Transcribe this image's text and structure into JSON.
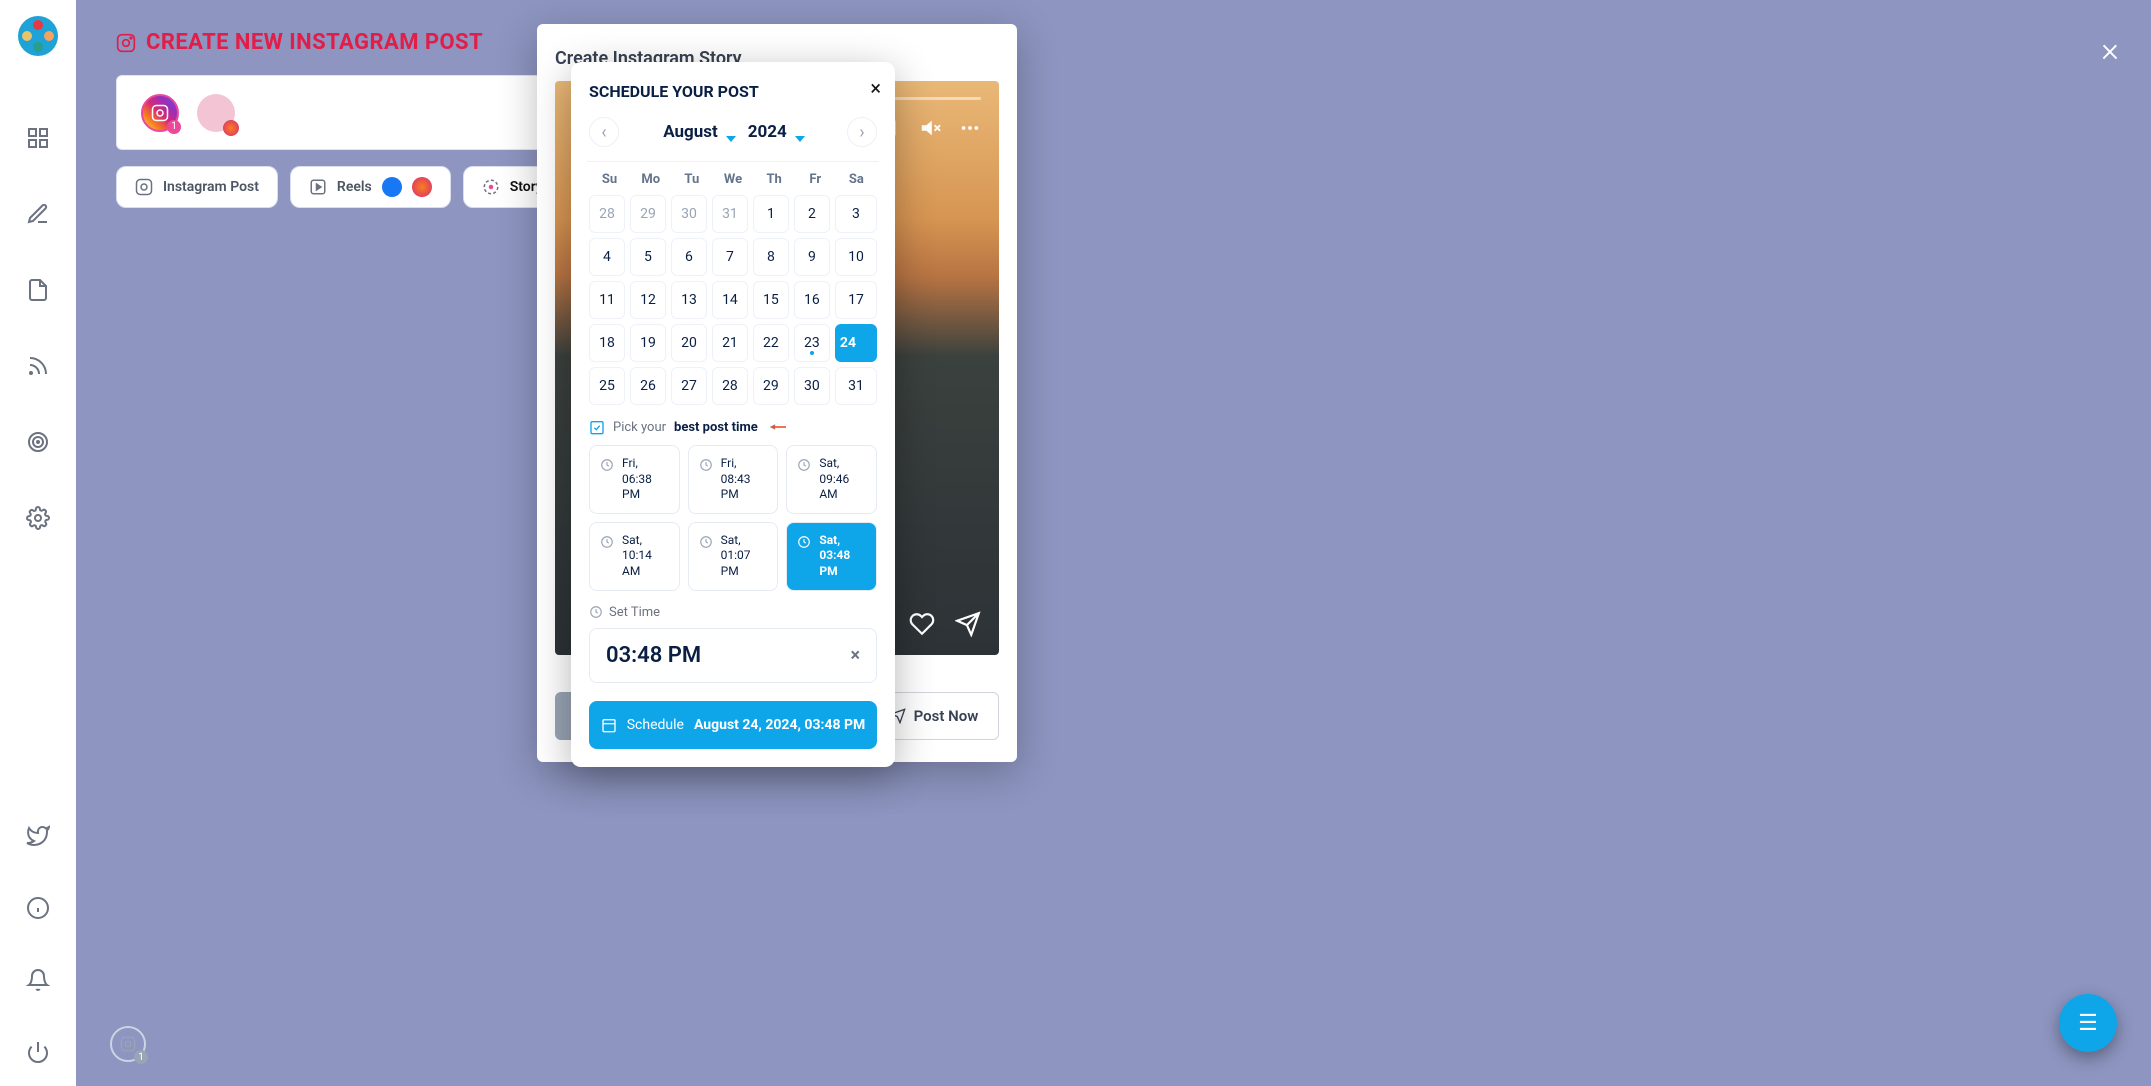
{
  "header": {
    "title": "CREATE NEW INSTAGRAM POST"
  },
  "tabs": {
    "instagram_post": "Instagram Post",
    "reels": "Reels",
    "story_post": "Story Post"
  },
  "account_badge": "1",
  "modal": {
    "title": "Create Instagram Story",
    "schedule_btn": "Schedule",
    "post_now": "Post Now",
    "save_later": ""
  },
  "popover": {
    "title": "SCHEDULE YOUR POST",
    "month": "August",
    "year": "2024",
    "dow": [
      "Su",
      "Mo",
      "Tu",
      "We",
      "Th",
      "Fr",
      "Sa"
    ],
    "prev_days": [
      "28",
      "29",
      "30",
      "31"
    ],
    "days": [
      "1",
      "2",
      "3",
      "4",
      "5",
      "6",
      "7",
      "8",
      "9",
      "10",
      "11",
      "12",
      "13",
      "14",
      "15",
      "16",
      "17",
      "18",
      "19",
      "20",
      "21",
      "22",
      "23",
      "24",
      "25",
      "26",
      "27",
      "28",
      "29",
      "30",
      "31"
    ],
    "today": "23",
    "selected_day": "24",
    "pick_label": "Pick your",
    "pick_bold": "best post time",
    "times": [
      {
        "label": "Fri, 06:38 PM",
        "sel": false
      },
      {
        "label": "Fri, 08:43 PM",
        "sel": false
      },
      {
        "label": "Sat, 09:46 AM",
        "sel": false
      },
      {
        "label": "Sat, 10:14 AM",
        "sel": false
      },
      {
        "label": "Sat, 01:07 PM",
        "sel": false
      },
      {
        "label": "Sat, 03:48 PM",
        "sel": true
      }
    ],
    "set_time_label": "Set Time",
    "time_value": "03:48 PM",
    "schedule_word": "Schedule",
    "schedule_date": "August 24, 2024, 03:48 PM"
  }
}
